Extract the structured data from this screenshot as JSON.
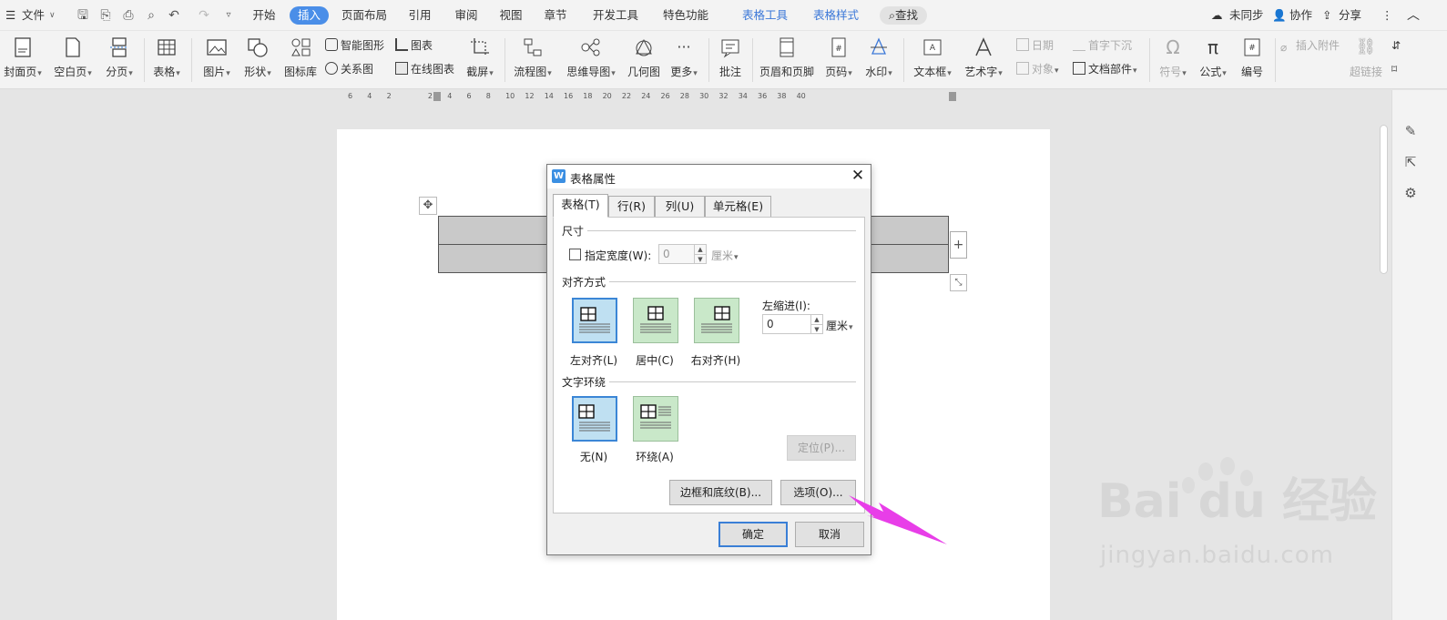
{
  "menubar": {
    "file_menu": "文件",
    "tabs": [
      "开始",
      "插入",
      "页面布局",
      "引用",
      "审阅",
      "视图",
      "章节",
      "开发工具",
      "特色功能"
    ],
    "context_tabs": [
      "表格工具",
      "表格样式"
    ],
    "active_tab": "插入",
    "search_label": "查找",
    "sync_label": "未同步",
    "collab_label": "协作",
    "share_label": "分享"
  },
  "ribbon": {
    "big": [
      "封面页",
      "空白页",
      "分页",
      "表格",
      "图片",
      "形状",
      "图标库"
    ],
    "small_smartart": "智能图形",
    "small_chart": "图表",
    "small_relation": "关系图",
    "small_online_chart": "在线图表",
    "screenshot": "截屏",
    "flowchart": "流程图",
    "mindmap": "思维导图",
    "geometry": "几何图",
    "more": "更多",
    "comment": "批注",
    "header_footer": "页眉和页脚",
    "page_number": "页码",
    "watermark": "水印",
    "textbox": "文本框",
    "wordart": "艺术字",
    "date": "日期",
    "dropcap": "首字下沉",
    "object": "对象",
    "doc_parts": "文档部件",
    "symbol": "符号",
    "formula": "公式",
    "numbering": "编号",
    "attachment": "插入附件",
    "hyperlink": "超链接"
  },
  "ruler": {
    "numbers": [
      "6",
      "4",
      "2",
      "2",
      "4",
      "6",
      "8",
      "10",
      "12",
      "14",
      "16",
      "18",
      "20",
      "22",
      "24",
      "26",
      "28",
      "30",
      "32",
      "34",
      "36",
      "38",
      "40"
    ]
  },
  "dialog": {
    "title": "表格属性",
    "tabs": [
      "表格(T)",
      "行(R)",
      "列(U)",
      "单元格(E)"
    ],
    "active_tab": "表格(T)",
    "size_group": "尺寸",
    "specify_width_label": "指定宽度(W):",
    "width_value": "0",
    "width_unit": "厘米",
    "align_group": "对齐方式",
    "align_options": [
      "左对齐(L)",
      "居中(C)",
      "右对齐(H)"
    ],
    "selected_align": "左对齐(L)",
    "indent_label": "左缩进(I):",
    "indent_value": "0",
    "indent_unit": "厘米",
    "wrap_group": "文字环绕",
    "wrap_options": [
      "无(N)",
      "环绕(A)"
    ],
    "selected_wrap": "无(N)",
    "position_button": "定位(P)...",
    "borders_button": "边框和底纹(B)...",
    "options_button": "选项(O)...",
    "ok_button": "确定",
    "cancel_button": "取消"
  },
  "watermark": {
    "logo_text": "Bai du 经验",
    "url": "jingyan.baidu.com"
  },
  "colors": {
    "accent": "#4a8ee8",
    "arrow": "#e83ee8"
  }
}
